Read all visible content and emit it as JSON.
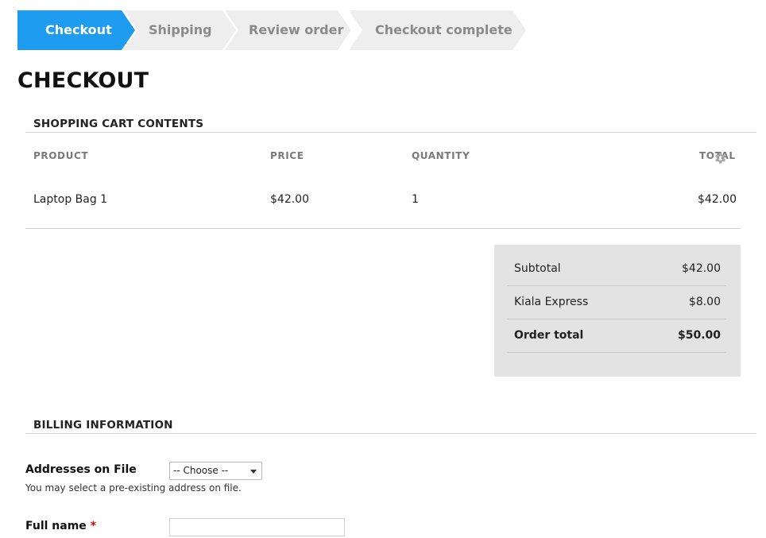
{
  "steps": [
    {
      "label": "Checkout",
      "active": true
    },
    {
      "label": "Shipping",
      "active": false
    },
    {
      "label": "Review order",
      "active": false
    },
    {
      "label": "Checkout complete",
      "active": false
    }
  ],
  "colors": {
    "active_step": "#1e9cf0",
    "inactive_step": "#eeeeee",
    "totals_bg": "#e3e3e3",
    "required": "#e00000"
  },
  "page_title": "CHECKOUT",
  "cart": {
    "legend": "SHOPPING CART CONTENTS",
    "columns": [
      "PRODUCT",
      "PRICE",
      "QUANTITY",
      "TOTAL"
    ],
    "rows": [
      {
        "product": "Laptop Bag 1",
        "price": "$42.00",
        "quantity": "1",
        "total": "$42.00"
      }
    ],
    "settings_icon": "gear-icon"
  },
  "totals": [
    {
      "label": "Subtotal",
      "value": "$42.00",
      "bold": false
    },
    {
      "label": "Kiala Express",
      "value": "$8.00",
      "bold": false
    },
    {
      "label": "Order total",
      "value": "$50.00",
      "bold": true
    }
  ],
  "billing": {
    "legend": "BILLING INFORMATION",
    "addresses_label": "Addresses on File",
    "addresses_selected": "-- Choose --",
    "addresses_help": "You may select a pre-existing address on file.",
    "full_name_label": "Full name",
    "required_marker": "*",
    "full_name_value": ""
  }
}
